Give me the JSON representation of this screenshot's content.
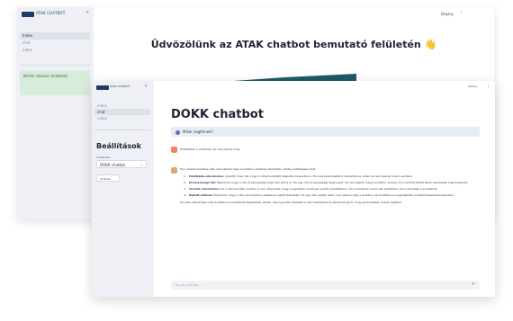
{
  "back_window": {
    "brand": "ATAK CHATBOT",
    "nav": [
      "Index",
      "chat",
      "index"
    ],
    "alert_text": "Kérlek válassz chatbotot.",
    "deploy": "Deploy",
    "menu_icon": "⋮",
    "close_icon": "×",
    "title": "Üdvözölünk az ATAK chatbot bemutató felületén 👋"
  },
  "front_window": {
    "brand": "ATAK CHATBOT",
    "nav": [
      "index",
      "chat",
      "index"
    ],
    "settings_title": "Beállítások",
    "chatbot_label": "Chatbotok",
    "chatbot_selected": "DOKK chatbot",
    "clear_button": "Új téma",
    "deploy": "Deploy",
    "menu_icon": "⋮",
    "close_icon": "×",
    "chevron": "⌄",
    "page_title": "DOKK chatbot",
    "question": "Mikor segítenek?",
    "warning_text": "Elnézettem a cikkemet, de nem jelenik meg.",
    "answer_intro": "Ha a cikked mentése után nem jelenik meg a portálon, érdemes ellenőrizni néhány lehetséges okot:",
    "answer_items": [
      {
        "num": "1.",
        "bold": "Publikálás ellenőrzése:",
        "text": " Győződj meg róla, hogy a cikket publikált állapotba helyezted-e. Ha csak piszkozatként mentetted el, akkor az nem jelenik meg a portálon."
      },
      {
        "num": "2.",
        "bold": "Érvényességi idő:",
        "text": " Ellenőrizd, hogy a cikk érvényességi ideje nem járt-e le. Ha egy cikk érvényességi ideje lejárt, az nem jelenik meg a portálon, kivéve, ha a verziók között külső valamelyik még érvényes."
      },
      {
        "num": "3.",
        "bold": "Verziók ellenőrzése:",
        "text": " Ha a cikknek több verziója is van, ellenőrizd, hogy a legutóbbi, érvényes verziót publikáltad-e. Ha a közbenső verzió lett publikálva, ez is okozhatja a problémát."
      },
      {
        "num": "4.",
        "bold": "Rejtett státusz:",
        "text": " Ellenőrizd, hogy a cikk nem került-e véletlenül rejtett státuszba. Ha egy cikk rejtett, akkor nem jelenik meg a portálon, de továbbra is megtalálható a tartalomkezelőrendszerben."
      }
    ],
    "answer_footer": "Ha ezek ellenőrzése után továbbra is problémát tapasztalsz, kérlek, adj meg több részletet a cikk mentéséről és körülményeiről, hogy pontosabban tudjak segíteni!",
    "input_placeholder": "Írja ide a kérdést...",
    "send_icon": "➤"
  }
}
